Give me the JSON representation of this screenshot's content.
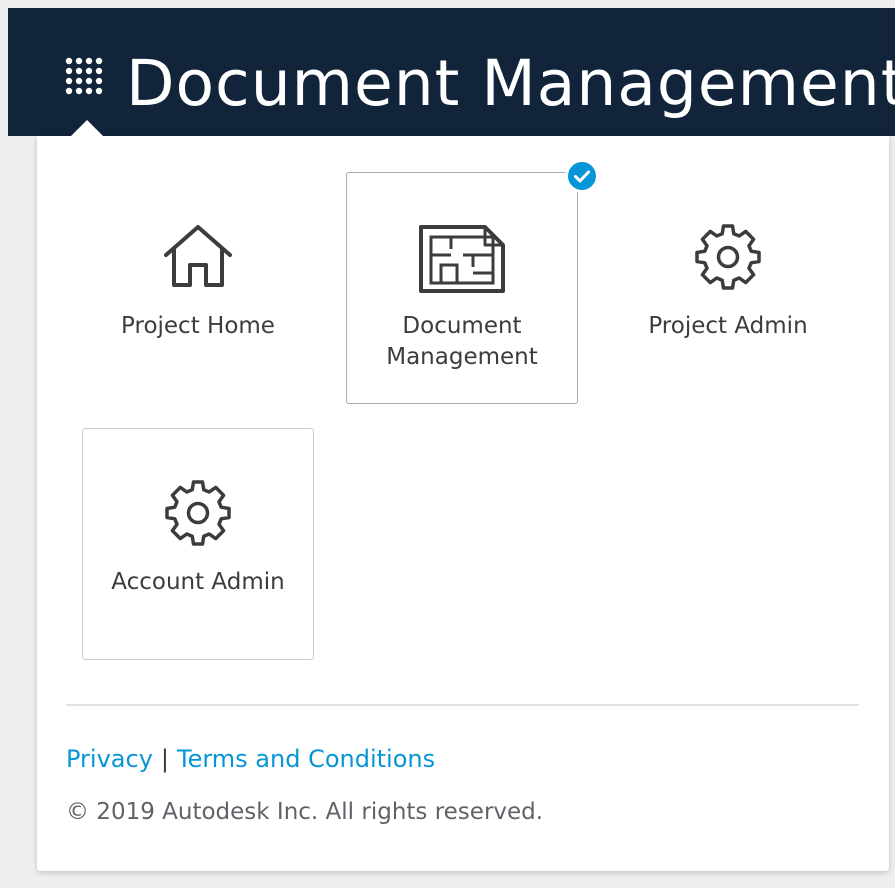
{
  "header": {
    "app_switcher_icon": "grid-dots-icon",
    "title": "Document Management",
    "background_color": "#12243a"
  },
  "tiles": [
    {
      "label": "Project Home",
      "icon": "house-icon",
      "selected": false
    },
    {
      "label": "Document\nManagement",
      "label_line1": "Document",
      "label_line2": "Management",
      "icon": "floorplan-document-icon",
      "selected": true
    },
    {
      "label": "Project Admin",
      "icon": "gear-icon",
      "selected": false
    },
    {
      "label": "Account Admin",
      "icon": "gear-icon",
      "selected": false
    }
  ],
  "selected_badge_icon": "checkmark-icon",
  "footer": {
    "privacy_label": "Privacy",
    "separator": "|",
    "terms_label": "Terms and Conditions",
    "copyright": "© 2019 Autodesk Inc. All rights reserved.",
    "link_color": "#0696d7"
  },
  "accent_color": "#0696d7"
}
